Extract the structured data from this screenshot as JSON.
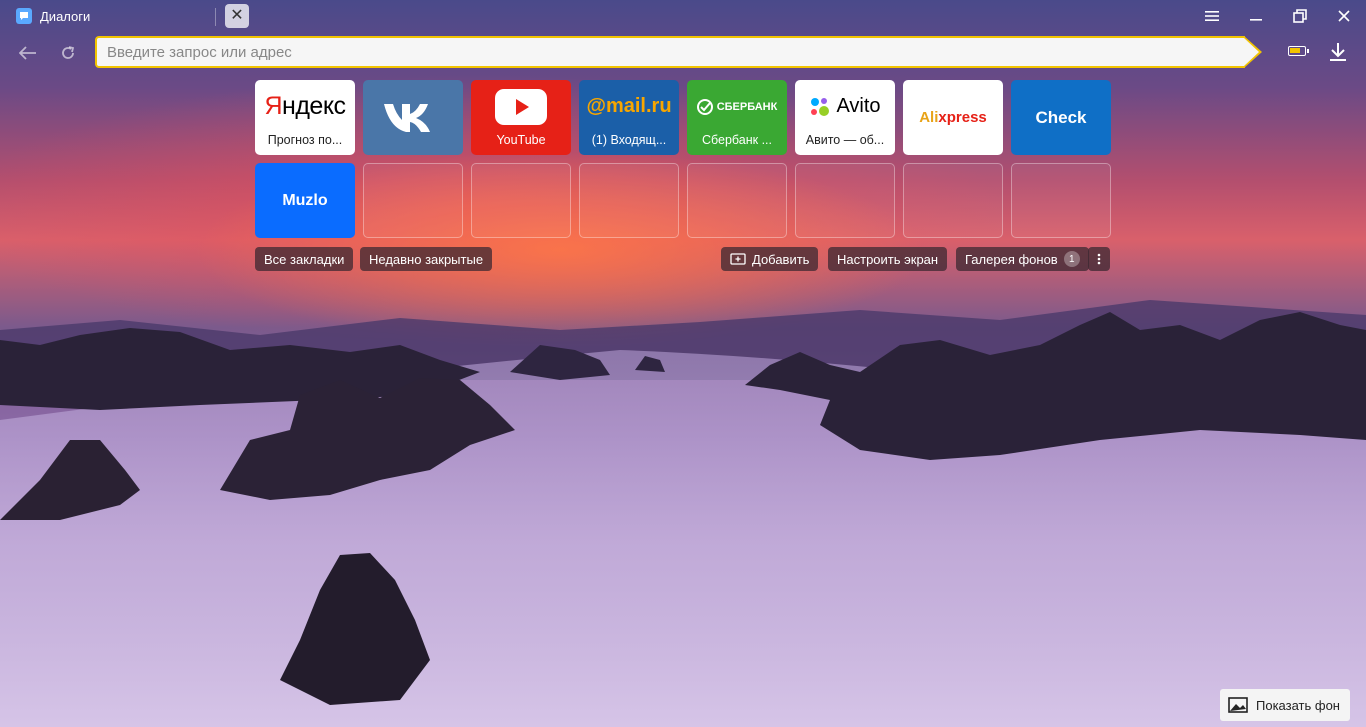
{
  "tab": {
    "title": "Диалоги",
    "icon": "chat-bubble-icon"
  },
  "window_controls": {
    "menu": "hamburger-menu-icon",
    "minimize": "minimize-icon",
    "restore": "restore-icon",
    "close": "close-icon"
  },
  "omnibox": {
    "placeholder": "Введите запрос или адрес",
    "value": ""
  },
  "tiles": [
    {
      "logo": "Яндекс",
      "caption": "Прогноз по..."
    },
    {
      "logo": "VK",
      "caption": ""
    },
    {
      "logo": "YouTube",
      "caption": "YouTube"
    },
    {
      "logo": "@mail.ru",
      "caption": "(1) Входящ..."
    },
    {
      "logo": "СБЕРБАНК",
      "caption": "Сбербанк ..."
    },
    {
      "logo": "Avito",
      "caption": "Авито — об..."
    },
    {
      "logo": "AliExpress",
      "caption": ""
    },
    {
      "logo": "Check",
      "caption": ""
    },
    {
      "logo": "Muzlo",
      "caption": ""
    }
  ],
  "colors": {
    "accent": "#f2c400",
    "vk": "#4a76a8",
    "youtube": "#e62117",
    "mailru": "#1b5fa8",
    "sberbank": "#3aa833",
    "check": "#0f6fc6",
    "muzlo": "#0a6cff"
  },
  "actions": {
    "all_bookmarks": "Все закладки",
    "recently_closed": "Недавно закрытые",
    "add": "Добавить",
    "customize": "Настроить экран",
    "gallery": "Галерея фонов",
    "gallery_count": "1"
  },
  "show_background": "Показать фон"
}
